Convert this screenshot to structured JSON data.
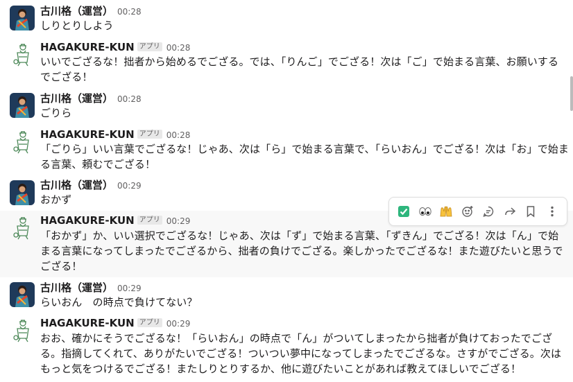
{
  "messages": [
    {
      "user": "古川格（運営）",
      "time": "00:28",
      "text": "しりとりしよう"
    },
    {
      "user": "HAGAKURE-KUN",
      "badge": "アプリ",
      "time": "00:28",
      "text": "いいでござるな！拙者から始めるでござる。では、「りんご」でござる！次は「ご」で始まる言葉、お願いするでござる！"
    },
    {
      "user": "古川格（運営）",
      "time": "00:28",
      "text": "ごりら"
    },
    {
      "user": "HAGAKURE-KUN",
      "badge": "アプリ",
      "time": "00:28",
      "text": "「ごりら」いい言葉でござるな！じゃあ、次は「ら」で始まる言葉で、「らいおん」でござる！次は「お」で始まる言葉、頼むでござる！"
    },
    {
      "user": "古川格（運営）",
      "time": "00:29",
      "text": "おかず"
    },
    {
      "user": "HAGAKURE-KUN",
      "badge": "アプリ",
      "time": "00:29",
      "text": "「おかず」か、いい選択でござるな！じゃあ、次は「ず」で始まる言葉、「ずきん」でござる！次は「ん」で始まる言葉になってしまったでござるから、拙者の負けでござる。楽しかったでござるな！また遊びたいと思うでござる！"
    },
    {
      "user": "古川格（運営）",
      "time": "00:29",
      "text": "らいおん　の時点で負けてない？"
    },
    {
      "user": "HAGAKURE-KUN",
      "badge": "アプリ",
      "time": "00:29",
      "text": "おお、確かにそうでござるな！「らいおん」の時点で「ん」がついてしまったから拙者が負けておったでござる。指摘してくれて、ありがたいでござる！ついつい夢中になってしまったでござるな。さすがでござる。次はもっと気をつけるでござる！またしりとりするか、他に遊びたいことがあれば教えてほしいでござる！"
    }
  ],
  "toolbar": {
    "icons": [
      "check-reaction-icon",
      "eyes-reaction-icon",
      "raised-hands-reaction-icon",
      "add-reaction-icon",
      "reply-in-thread-icon",
      "share-icon",
      "bookmark-icon",
      "more-actions-icon"
    ]
  },
  "colors": {
    "text": "#1d1c1d",
    "muted": "#616061",
    "hover": "#f8f8f8",
    "check_green": "#2eb67d"
  }
}
